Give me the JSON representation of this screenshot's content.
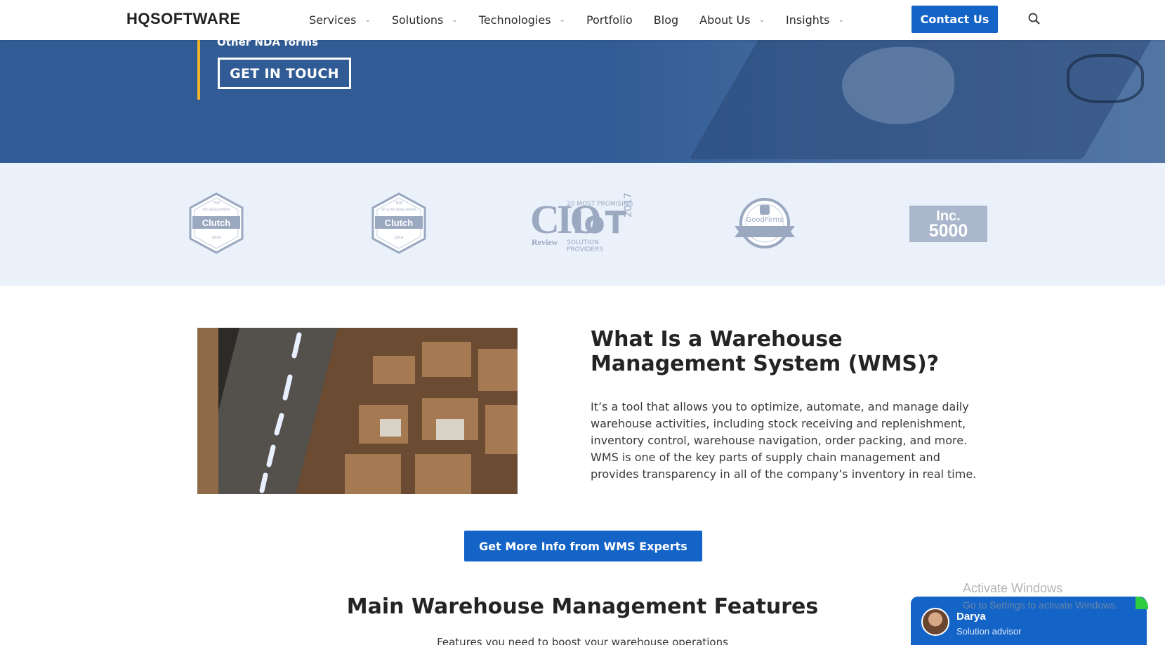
{
  "header": {
    "logo": "HQSOFTWARE",
    "nav": [
      {
        "label": "Services",
        "dropdown": true
      },
      {
        "label": "Solutions",
        "dropdown": true
      },
      {
        "label": "Technologies",
        "dropdown": true
      },
      {
        "label": "Portfolio",
        "dropdown": false
      },
      {
        "label": "Blog",
        "dropdown": false
      },
      {
        "label": "About Us",
        "dropdown": true
      },
      {
        "label": "Insights",
        "dropdown": true
      }
    ],
    "contact_label": "Contact Us",
    "search_icon": "search-icon"
  },
  "hero": {
    "cut_text": "Other NDA forms",
    "cta_label": "GET IN TOUCH",
    "accent_color": "#f0b429",
    "bg_color": "#315b95"
  },
  "badges": {
    "clutch1": {
      "top": "TOP",
      "line": "IOT DEVELOPERS",
      "brand": "Clutch",
      "year": "2019"
    },
    "clutch2": {
      "top": "TOP",
      "line": "VR & AR DEVELOPERS",
      "brand": "Clutch",
      "year": "2018"
    },
    "cio": {
      "brand": "CIO",
      "review": "Review",
      "top_line": "20 MOST PROMISING",
      "iot": "IoT",
      "year": "2017",
      "bottom_line": "SOLUTION PROVIDERS"
    },
    "goodfirms": {
      "brand": "GoodFirms"
    },
    "inc": {
      "line1": "Inc.",
      "line2": "5000"
    }
  },
  "wms": {
    "title": "What Is a Warehouse Management System (WMS)?",
    "text": "It’s a tool that allows you to optimize, automate, and manage daily warehouse activities, including stock receiving and replenishment, inventory control, warehouse navigation, order packing, and more. WMS is one of the key parts of supply chain management and provides transparency in all of the company’s inventory in real time.",
    "cta_label": "Get More Info from WMS Experts"
  },
  "features": {
    "title": "Main Warehouse Management Features",
    "subtitle": "Features you need to boost your warehouse operations"
  },
  "watermark": {
    "title": "Activate Windows",
    "subtitle": "Go to Settings to activate Windows."
  },
  "chat": {
    "name": "Darya",
    "role": "Solution advisor"
  },
  "colors": {
    "primary": "#1464c8",
    "badge_bg": "#eaf1fb",
    "badge_gray": "#9aa8c0"
  }
}
